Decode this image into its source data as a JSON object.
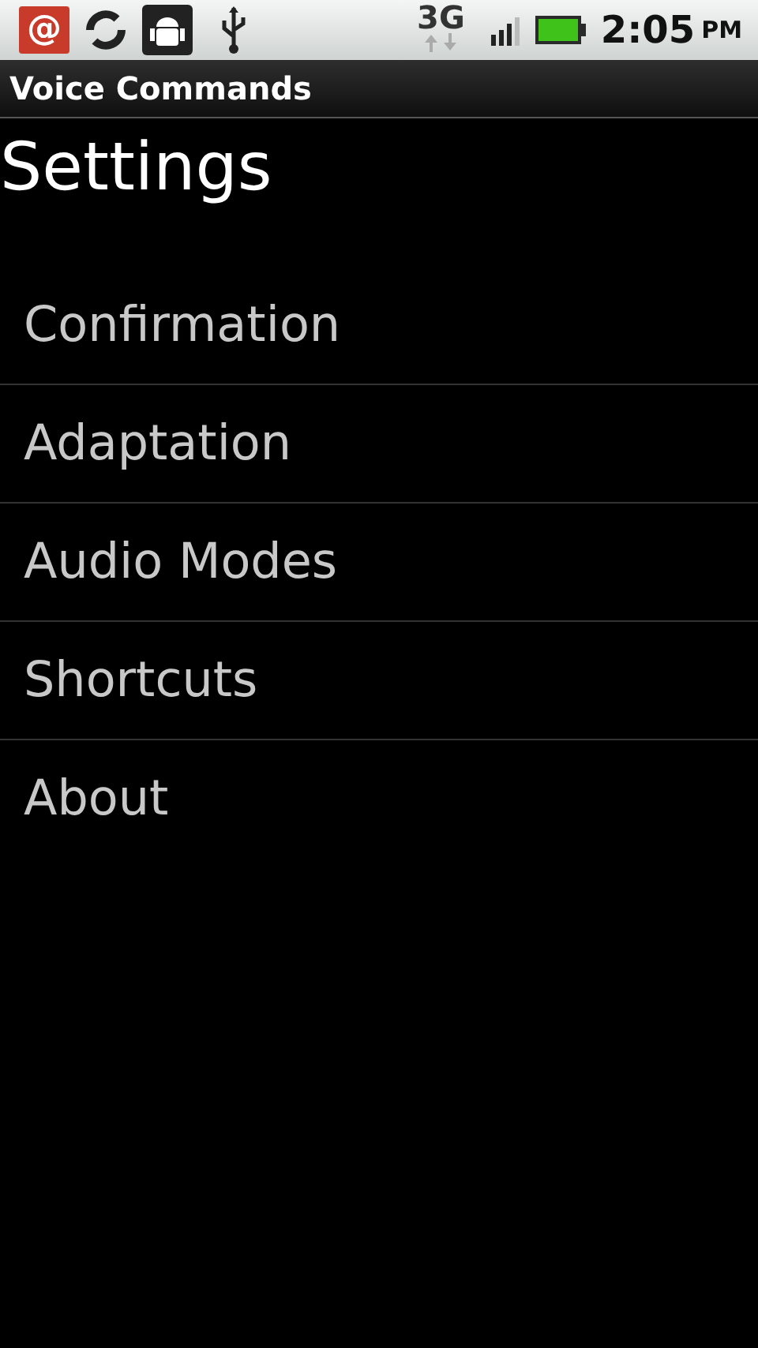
{
  "status_bar": {
    "mail_glyph": "@",
    "network": "3G",
    "time": "2:05",
    "period": "PM"
  },
  "title_bar": {
    "title": "Voice Commands"
  },
  "heading": "Settings",
  "items": [
    {
      "label": "Confirmation"
    },
    {
      "label": "Adaptation"
    },
    {
      "label": "Audio Modes"
    },
    {
      "label": "Shortcuts"
    },
    {
      "label": "About"
    }
  ]
}
